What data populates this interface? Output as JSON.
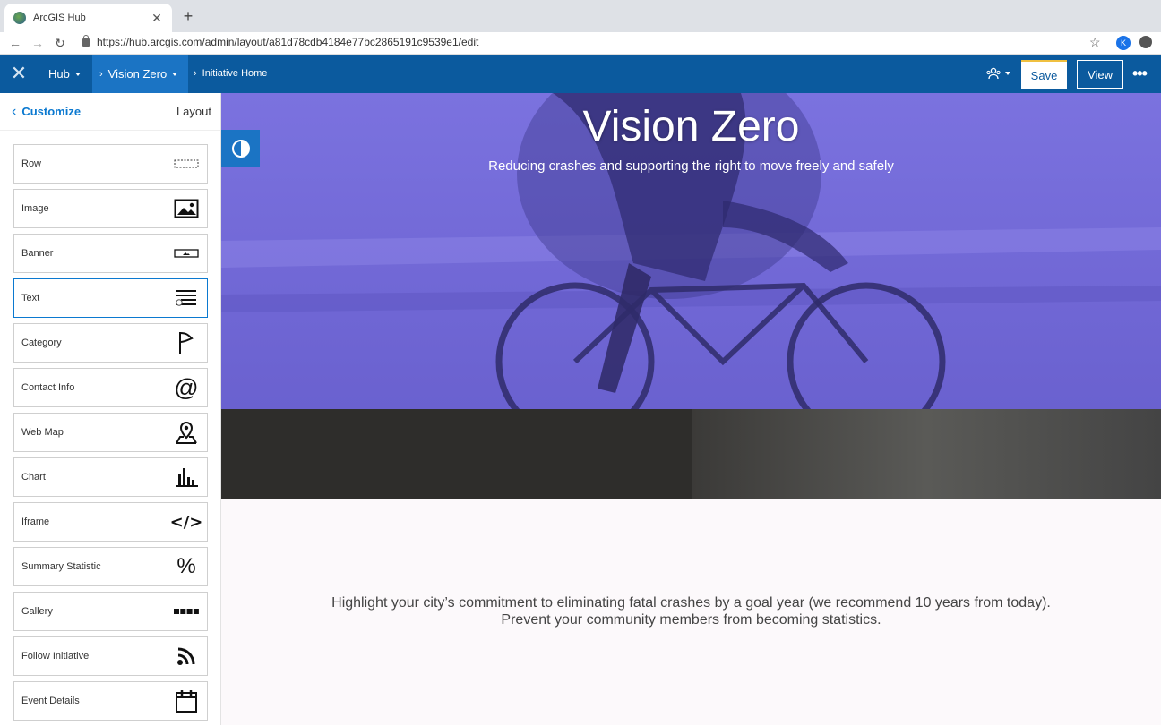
{
  "browser": {
    "tab_title": "ArcGIS Hub",
    "tab_close": "✕",
    "new_tab": "+",
    "url": "https://hub.arcgis.com/admin/layout/a81d78cdb4184e77bc2865191c9539e1/edit",
    "avatar_letter": "K"
  },
  "header": {
    "hub_label": "Hub",
    "site_label": "Vision Zero",
    "page_label": "Initiative Home",
    "save_label": "Save",
    "view_label": "View",
    "more_label": "•••"
  },
  "sidebar": {
    "back_label": "Customize",
    "title": "Layout",
    "cards": [
      {
        "label": "Row",
        "icon": "row-icon"
      },
      {
        "label": "Image",
        "icon": "image-icon"
      },
      {
        "label": "Banner",
        "icon": "banner-icon"
      },
      {
        "label": "Text",
        "icon": "text-icon"
      },
      {
        "label": "Category",
        "icon": "flag-icon"
      },
      {
        "label": "Contact Info",
        "icon": "at-icon"
      },
      {
        "label": "Web Map",
        "icon": "map-pin-icon"
      },
      {
        "label": "Chart",
        "icon": "bar-chart-icon"
      },
      {
        "label": "Iframe",
        "icon": "code-icon"
      },
      {
        "label": "Summary Statistic",
        "icon": "percent-icon"
      },
      {
        "label": "Gallery",
        "icon": "gallery-icon"
      },
      {
        "label": "Follow Initiative",
        "icon": "rss-icon"
      },
      {
        "label": "Event Details",
        "icon": "calendar-icon"
      }
    ],
    "icon_glyphs": {
      "at": "@",
      "code": "</>",
      "percent": "%"
    }
  },
  "main": {
    "hero_title": "Vision Zero",
    "hero_subtitle": "Reducing crashes and supporting the right to move freely and safely",
    "body_line1": "Highlight your city’s commitment to eliminating fatal crashes by a goal year (we recommend 10 years from today).",
    "body_line2": "Prevent your community members from becoming statistics."
  },
  "colors": {
    "header_bg": "#0b5a9e",
    "accent": "#1b74c4",
    "link": "#0b79d0",
    "hero_tint": "#6b62d3"
  }
}
